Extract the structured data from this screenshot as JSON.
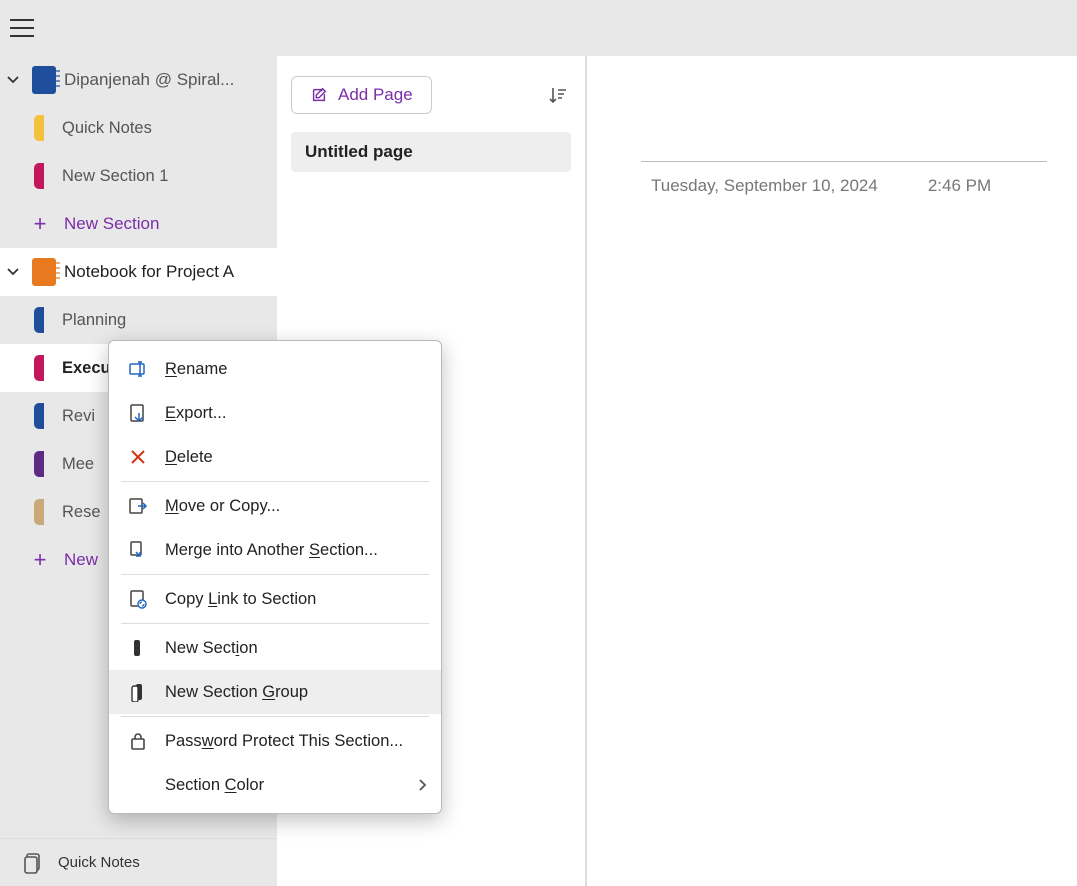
{
  "notebooks": [
    {
      "id": "nb1",
      "label": "Dipanjenah @ Spiral...",
      "color": "#1f4e9c",
      "expanded": true,
      "selected": false,
      "sections": [
        {
          "label": "Quick Notes",
          "color": "#f3c23a"
        },
        {
          "label": "New Section 1",
          "color": "#c2185b"
        }
      ],
      "new_section_label": "New Section"
    },
    {
      "id": "nb2",
      "label": "Notebook for Project A",
      "color": "#e8791e",
      "expanded": true,
      "selected": true,
      "sections": [
        {
          "label": "Planning",
          "color": "#1f4e9c"
        },
        {
          "label": "Execution",
          "color": "#c2185b",
          "active": true
        },
        {
          "label": "Revi",
          "color": "#1f4e9c"
        },
        {
          "label": "Mee",
          "color": "#5e2a84"
        },
        {
          "label": "Rese",
          "color": "#c9a978"
        }
      ],
      "new_section_label": "New"
    }
  ],
  "sidebar_footer": {
    "label": "Quick Notes"
  },
  "pages": {
    "add_label": "Add Page",
    "items": [
      {
        "title": "Untitled page"
      }
    ]
  },
  "editor": {
    "date": "Tuesday, September 10, 2024",
    "time": "2:46 PM"
  },
  "context_menu": {
    "items": [
      {
        "icon": "rename",
        "pre": "",
        "u": "R",
        "post": "ename"
      },
      {
        "icon": "export",
        "pre": "",
        "u": "E",
        "post": "xport..."
      },
      {
        "icon": "delete",
        "pre": "",
        "u": "D",
        "post": "elete"
      },
      {
        "sep": true
      },
      {
        "icon": "move",
        "pre": "",
        "u": "M",
        "post": "ove or Copy..."
      },
      {
        "icon": "merge",
        "pre": "Merge into Another ",
        "u": "S",
        "post": "ection..."
      },
      {
        "sep": true
      },
      {
        "icon": "link",
        "pre": "Copy ",
        "u": "L",
        "post": "ink to Section"
      },
      {
        "sep": true
      },
      {
        "icon": "section",
        "pre": "New Sect",
        "u": "i",
        "post": "on"
      },
      {
        "icon": "group",
        "pre": "New Section ",
        "u": "G",
        "post": "roup",
        "hover": true
      },
      {
        "sep": true
      },
      {
        "icon": "lock",
        "pre": "Pass",
        "u": "w",
        "post": "ord Protect This Section..."
      },
      {
        "icon": "",
        "pre": "Section ",
        "u": "C",
        "post": "olor",
        "submenu": true
      }
    ]
  }
}
